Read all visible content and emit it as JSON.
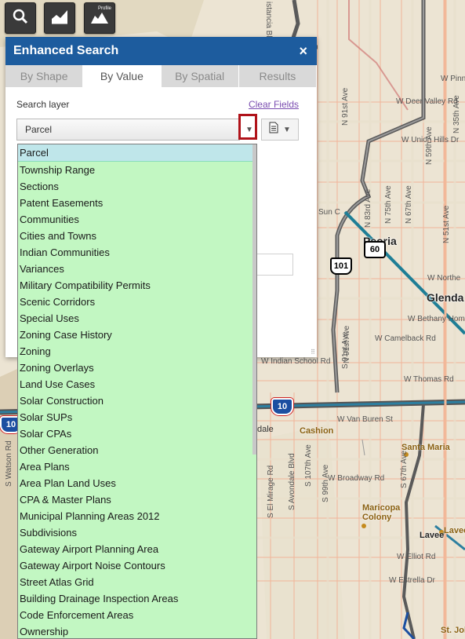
{
  "toolbar": {
    "buttons": [
      {
        "icon": "search-icon",
        "badge": ""
      },
      {
        "icon": "chart-icon",
        "badge": ""
      },
      {
        "icon": "elevation-profile-icon",
        "badge": "Profile"
      }
    ]
  },
  "panel": {
    "title": "Enhanced Search",
    "close_label": "×",
    "tabs": [
      "By Shape",
      "By Value",
      "By Spatial",
      "Results"
    ],
    "active_tab": "By Value",
    "search_layer_label": "Search layer",
    "clear_fields_label": "Clear Fields",
    "selected_layer": "Parcel"
  },
  "dropdown": {
    "options": [
      "Parcel",
      "Township Range",
      "Sections",
      "Patent Easements",
      "Communities",
      "Cities and Towns",
      "Indian Communities",
      "Variances",
      "Military Compatibility Permits",
      "Scenic Corridors",
      "Special Uses",
      "Zoning Case History",
      "Zoning",
      "Zoning Overlays",
      "Land Use Cases",
      "Solar Construction",
      "Solar SUPs",
      "Solar CPAs",
      "Other Generation",
      "Area Plans",
      "Area Plan Land Uses",
      "CPA & Master Plans",
      "Municipal Planning Areas 2012",
      "Subdivisions",
      "Gateway Airport Planning Area",
      "Gateway Airport Noise Contours",
      "Street Atlas Grid",
      "Building Drainage Inspection Areas",
      "Code Enforcement Areas",
      "Ownership"
    ]
  },
  "map": {
    "street_labels": [
      "W Deer Valley Rd",
      "W Union Hills Dr",
      "W Pinna",
      "W Northe",
      "W Bethany Home",
      "W Camelback Rd",
      "W Indian School Rd",
      "W Thomas Rd",
      "W Van Buren St",
      "W Broadway Rd",
      "W Elliot Rd",
      "W Estrella Dr",
      "S Watson Rd",
      "S El Mirage Rd",
      "S Avondale Blvd",
      "S 107th Ave",
      "S 99th Ave",
      "S 91st Ave",
      "S 67th Ave",
      "N 91st Ave",
      "N 83rd Ave",
      "N 75th Ave",
      "N 67th Ave",
      "N 59th Ave",
      "N 51st Ave",
      "N 35th Ave",
      "N 91st Ave",
      "istancia Blvd",
      "Sun C",
      "dale"
    ],
    "cities": [
      "Peoria",
      "Glenda"
    ],
    "places": [
      "Cashion",
      "Santa Maria",
      "Maricopa Colony",
      "Lavee",
      "Lavee",
      "St. Joh"
    ],
    "shields": [
      "101",
      "60",
      "10",
      "10"
    ]
  }
}
